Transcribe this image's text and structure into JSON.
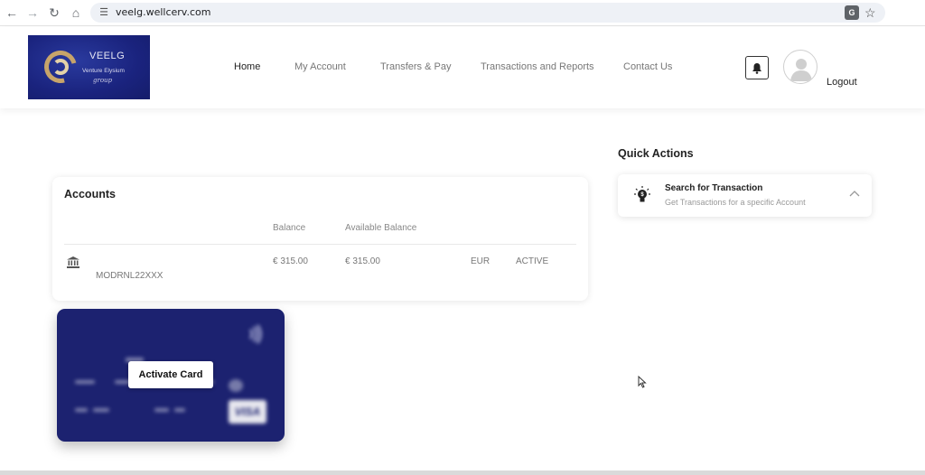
{
  "browser": {
    "url": "veelg.wellcerv.com",
    "back_icon": "arrow-left-icon",
    "forward_icon": "arrow-right-icon",
    "reload_icon": "reload-icon",
    "home_icon": "home-icon",
    "translate_icon": "translate-icon",
    "bookmark_icon": "star-icon"
  },
  "logo": {
    "title": "VEELG",
    "subtitle": "Venture Elysium",
    "signature": "group"
  },
  "nav": {
    "items": [
      {
        "label": "Home",
        "active": true
      },
      {
        "label": "My Account",
        "active": false
      },
      {
        "label": "Transfers & Pay",
        "active": false
      },
      {
        "label": "Transactions and Reports",
        "active": false
      },
      {
        "label": "Contact Us",
        "active": false
      }
    ],
    "logout": "Logout"
  },
  "accounts": {
    "title": "Accounts",
    "columns": {
      "balance": "Balance",
      "available": "Available Balance"
    },
    "rows": [
      {
        "bic": "MODRNL22XXX",
        "balance": "€ 315.00",
        "available": "€ 315.00",
        "currency": "EUR",
        "status": "ACTIVE"
      }
    ]
  },
  "card": {
    "activate_label": "Activate Card",
    "brand": "VISA",
    "background_color": "#1c2270"
  },
  "quick_actions": {
    "title": "Quick Actions",
    "items": [
      {
        "title": "Search for Transaction",
        "subtitle": "Get Transactions for a specific Account"
      }
    ]
  },
  "colors": {
    "accent": "#1c2270",
    "logo_gold": "#c7a46a"
  }
}
